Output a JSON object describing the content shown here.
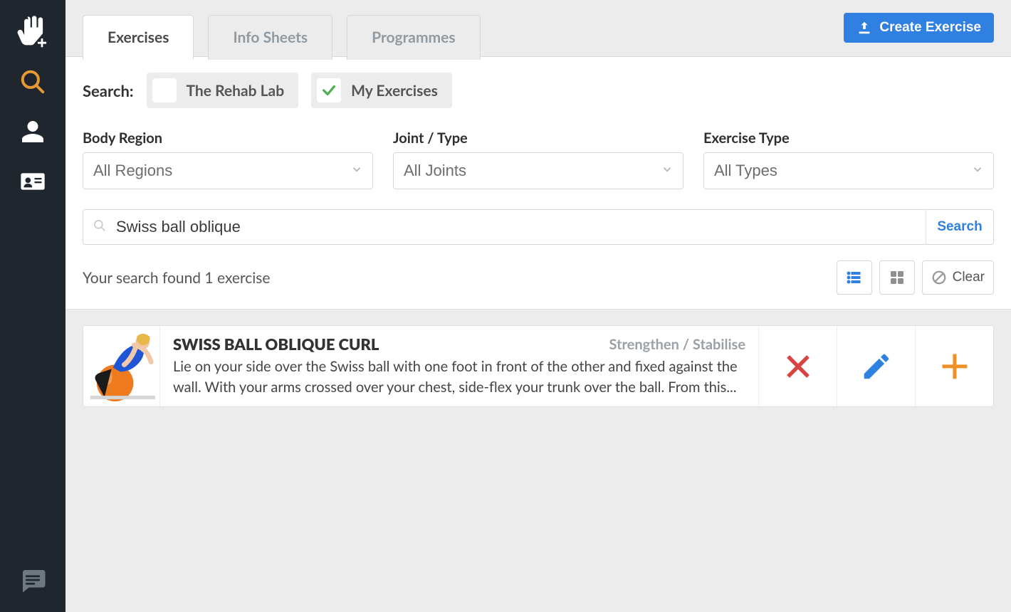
{
  "sidebar": {
    "items": [
      "logo",
      "search",
      "profile",
      "contacts",
      "chat"
    ]
  },
  "tabs": {
    "list": [
      {
        "label": "Exercises",
        "active": true
      },
      {
        "label": "Info Sheets",
        "active": false
      },
      {
        "label": "Programmes",
        "active": false
      }
    ]
  },
  "header": {
    "create_label": "Create Exercise"
  },
  "search_sources": {
    "label": "Search:",
    "items": [
      {
        "label": "The Rehab Lab",
        "checked": false
      },
      {
        "label": "My Exercises",
        "checked": true
      }
    ]
  },
  "filters": {
    "body_region": {
      "label": "Body Region",
      "value": "All Regions"
    },
    "joint_type": {
      "label": "Joint / Type",
      "value": "All Joints"
    },
    "exercise_type": {
      "label": "Exercise Type",
      "value": "All Types"
    }
  },
  "search": {
    "value": "Swiss ball oblique",
    "button": "Search"
  },
  "results": {
    "summary": "Your search found 1 exercise",
    "clear_label": "Clear",
    "items": [
      {
        "title": "SWISS BALL OBLIQUE CURL",
        "tag": "Strengthen / Stabilise",
        "description": "Lie on your side over the Swiss ball with one foot in front of the other and fixed against the wall. With your arms crossed over your chest, side-flex your trunk over the ball. From this..."
      }
    ]
  },
  "colors": {
    "accent": "#2f80e0",
    "danger": "#d64542",
    "add": "#ee9026",
    "edit": "#2f80e0"
  }
}
